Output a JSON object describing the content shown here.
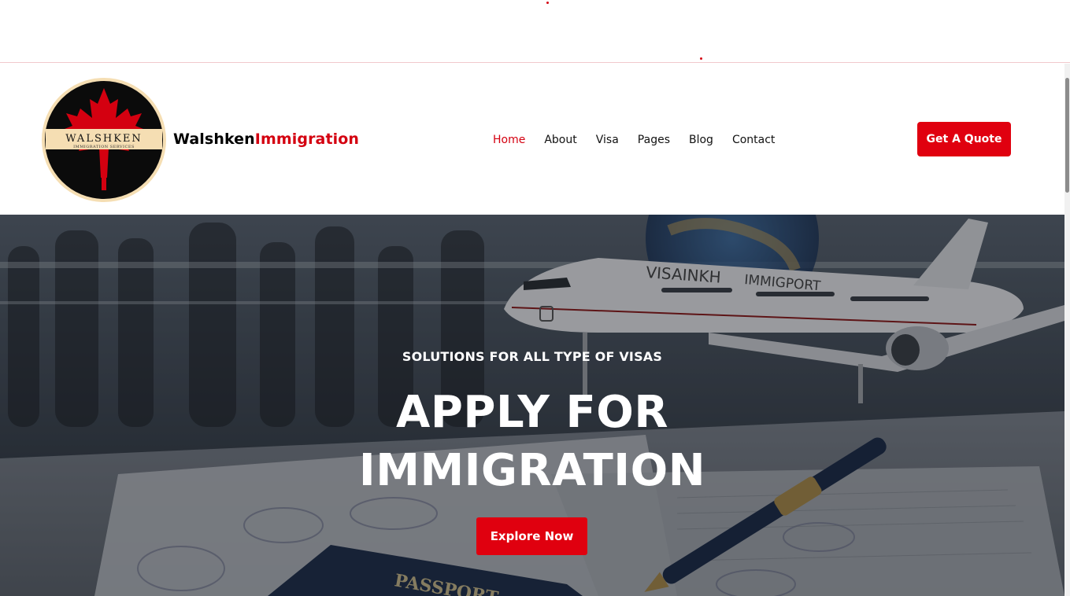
{
  "brand": {
    "name_part1": "Walshken",
    "name_part2": "Immigration",
    "logo_text_main": "WALSHKEN",
    "logo_text_sub": "IMMIGRATION SERVICES"
  },
  "nav": {
    "items": [
      {
        "label": "Home",
        "active": true
      },
      {
        "label": "About",
        "active": false
      },
      {
        "label": "Visa",
        "active": false
      },
      {
        "label": "Pages",
        "active": false
      },
      {
        "label": "Blog",
        "active": false
      },
      {
        "label": "Contact",
        "active": false
      }
    ],
    "cta_label": "Get A Quote"
  },
  "hero": {
    "subtitle": "SOLUTIONS FOR ALL TYPE OF VISAS",
    "headline_line1": "APPLY FOR",
    "headline_line2": "IMMIGRATION",
    "cta_label": "Explore Now",
    "image_text": {
      "plane_livery_1": "VISAINKH",
      "plane_livery_2": "IMMIGPORT",
      "passport": "PASSPORT"
    }
  },
  "colors": {
    "accent": "#e0000f",
    "active_nav": "#d40010",
    "text_dark": "#111111"
  }
}
